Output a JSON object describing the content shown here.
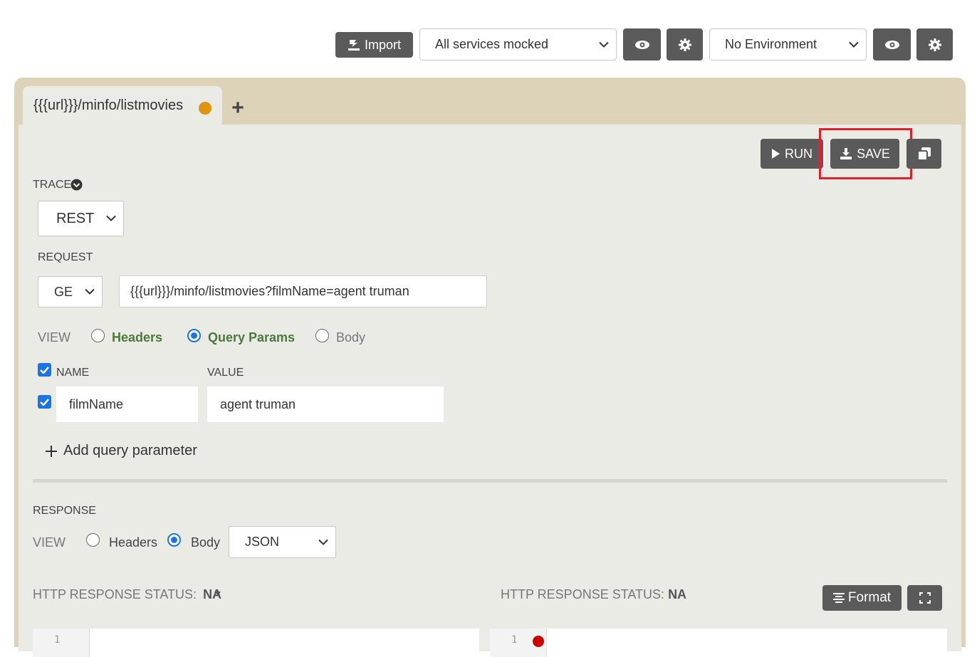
{
  "toolbar": {
    "import_label": "Import",
    "mock_select": "All services mocked",
    "env_select": "No Environment"
  },
  "tab": {
    "title": "{{{url}}}/minfo/listmovies",
    "add_symbol": "+"
  },
  "actions": {
    "run_label": "RUN",
    "save_label": "SAVE"
  },
  "trace": {
    "label": "TRACE",
    "protocol": "REST"
  },
  "request": {
    "label": "REQUEST",
    "method": "GE",
    "url": "{{{url}}}/minfo/listmovies?filmName=agent truman",
    "view_label": "VIEW",
    "view_options": [
      "Headers",
      "Query Params",
      "Body"
    ],
    "view_selected": "Query Params",
    "params": {
      "name_header": "NAME",
      "value_header": "VALUE",
      "rows": [
        {
          "name": "filmName",
          "value": "agent truman",
          "checked": true
        }
      ],
      "add_label": "Add query parameter"
    }
  },
  "response": {
    "label": "RESPONSE",
    "view_label": "VIEW",
    "view_options": [
      "Headers",
      "Body"
    ],
    "view_selected": "Body",
    "format_select": "JSON",
    "status_left_label": "HTTP RESPONSE STATUS:",
    "status_left_value": "NA",
    "status_right_label": "HTTP RESPONSE STATUS:",
    "status_right_value": "NA",
    "format_button": "Format",
    "editor_left_line": "1",
    "editor_right_line": "1"
  },
  "colors": {
    "accent": "#1a73e8",
    "dark_button": "#5a5a5a",
    "highlight": "#e0202a",
    "unsaved_dot": "#e09410",
    "outer_frame": "#ddd3b8",
    "panel": "#ebebe6"
  }
}
